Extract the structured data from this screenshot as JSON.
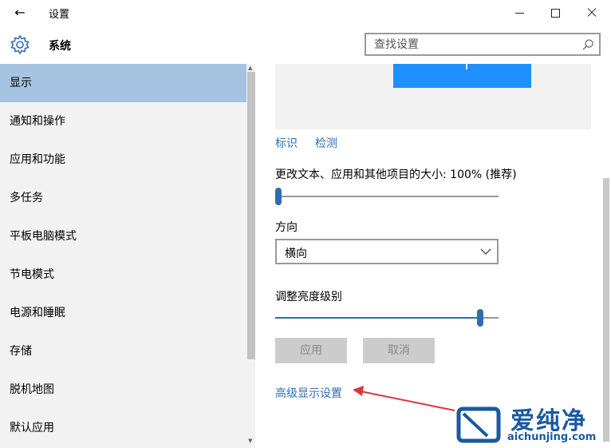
{
  "window": {
    "title": "设置"
  },
  "header": {
    "title": "系统",
    "search_placeholder": "查找设置"
  },
  "sidebar": {
    "items": [
      {
        "label": "显示",
        "active": true
      },
      {
        "label": "通知和操作"
      },
      {
        "label": "应用和功能"
      },
      {
        "label": "多任务"
      },
      {
        "label": "平板电脑模式"
      },
      {
        "label": "节电模式"
      },
      {
        "label": "电源和睡眠"
      },
      {
        "label": "存储"
      },
      {
        "label": "脱机地图"
      },
      {
        "label": "默认应用"
      }
    ]
  },
  "display": {
    "identify_link": "标识",
    "detect_link": "检测",
    "scale_label": "更改文本、应用和其他项目的大小: 100% (推荐)",
    "scale_fraction": 0.0,
    "orientation_label": "方向",
    "orientation_value": "横向",
    "brightness_label": "调整亮度级别",
    "brightness_fraction": 0.93,
    "apply_button": "应用",
    "cancel_button": "取消",
    "advanced_link": "高级显示设置"
  },
  "watermark": {
    "title": "爱纯净",
    "url": "aichunjing.com"
  },
  "colors": {
    "accent": "#2e6db4",
    "monitor": "#1e90ff",
    "selected": "#a6c4e2",
    "arrow": "#d9363e"
  }
}
